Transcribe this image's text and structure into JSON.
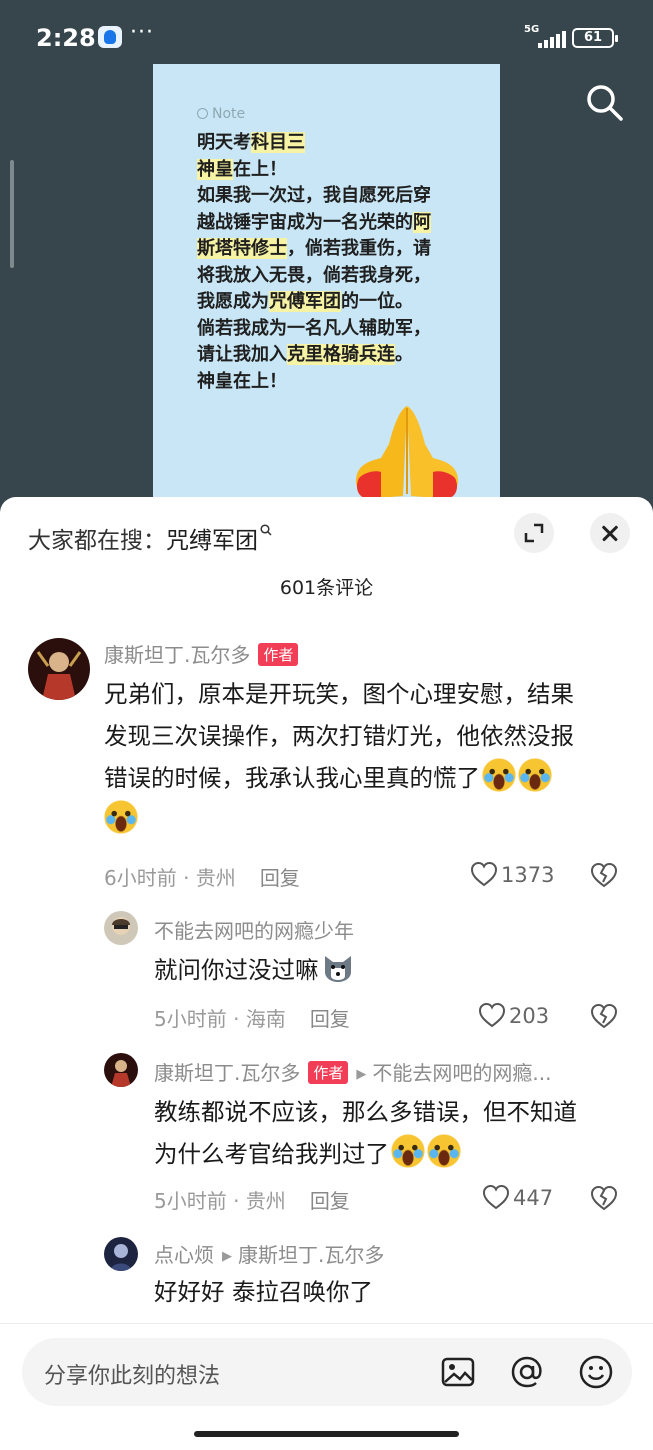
{
  "status": {
    "time": "2:28",
    "more": "···",
    "network": "5G",
    "battery": "61"
  },
  "note": {
    "label": "Note",
    "lines": [
      [
        {
          "t": "明天考",
          "h": false
        },
        {
          "t": "科目三",
          "h": true
        }
      ],
      [
        {
          "t": "神皇",
          "h": true
        },
        {
          "t": "在上！",
          "h": false
        }
      ],
      [
        {
          "t": "如果我一次过，我自愿死后穿",
          "h": false
        }
      ],
      [
        {
          "t": "越战锤宇宙成为一名光荣的",
          "h": false
        },
        {
          "t": "阿",
          "h": true
        }
      ],
      [
        {
          "t": "斯塔特修士",
          "h": true
        },
        {
          "t": "，倘若我重伤，请",
          "h": false
        }
      ],
      [
        {
          "t": "将我放入无畏，倘若我身死，",
          "h": false
        }
      ],
      [
        {
          "t": "我愿成为",
          "h": false
        },
        {
          "t": "咒傅军团",
          "h": true
        },
        {
          "t": "的一位。",
          "h": false
        }
      ],
      [
        {
          "t": "倘若我成为一名凡人辅助军，",
          "h": false
        }
      ],
      [
        {
          "t": "请让我加入",
          "h": false
        },
        {
          "t": "克里格骑兵连",
          "h": true
        },
        {
          "t": "。",
          "h": false
        }
      ],
      [
        {
          "t": "神皇在上！",
          "h": false
        }
      ]
    ],
    "emoji": "praying-hands"
  },
  "sheet": {
    "trending_prefix": "大家都在搜：",
    "trending_keyword": "咒缚军团",
    "comment_count": "601条评论"
  },
  "comments": [
    {
      "name": "康斯坦丁.瓦尔多",
      "tag": "作者",
      "line1": "兄弟们，原本是开玩笑，图个心理安慰，结果",
      "line2": "发现三次误操作，两次打错灯光，他依然没报",
      "line3": "错误的时候，我承认我心里真的慌了",
      "time": "6小时前",
      "location": "贵州",
      "reply": "回复",
      "likes": "1373"
    },
    {
      "name": "不能去网吧的网瘾少年",
      "text": "就问你过没过嘛",
      "time": "5小时前",
      "location": "海南",
      "reply": "回复",
      "likes": "203"
    },
    {
      "name": "康斯坦丁.瓦尔多",
      "tag": "作者",
      "reply_to": "不能去网吧的网瘾...",
      "line1": "教练都说不应该，那么多错误，但不知道",
      "line2": "为什么考官给我判过了",
      "time": "5小时前",
      "location": "贵州",
      "reply": "回复",
      "likes": "447"
    },
    {
      "name": "点心烦",
      "reply_to": "康斯坦丁.瓦尔多",
      "text": "好好好 泰拉召唤你了"
    }
  ],
  "input": {
    "placeholder": "分享你此刻的想法"
  },
  "colors": {
    "author_tag": "#f23d56",
    "note_bg": "#c8e6f5",
    "highlight": "#f6f3a5"
  }
}
